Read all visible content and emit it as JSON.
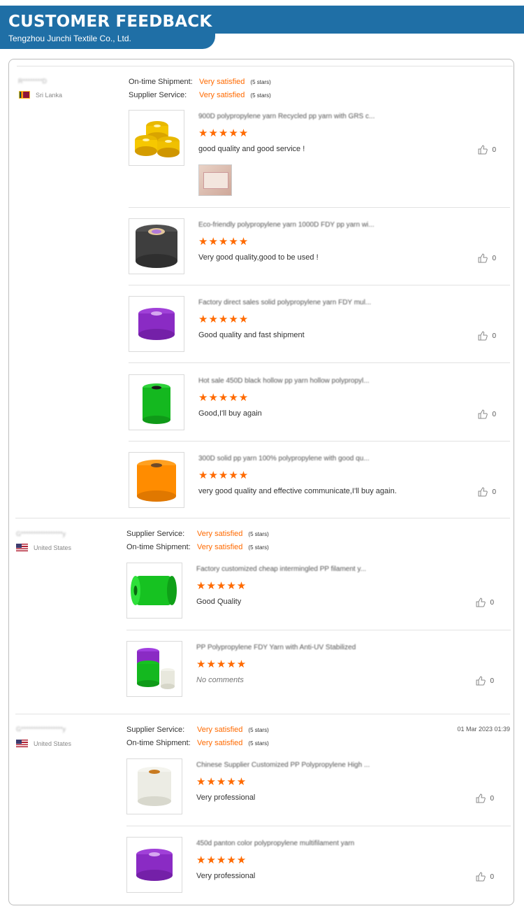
{
  "header": {
    "title": "CUSTOMER FEEDBACK",
    "subtitle": "Tengzhou Junchi Textile Co., Ltd."
  },
  "colors": {
    "brand": "#1f6fa6",
    "accent": "#ff6a00"
  },
  "reviews": [
    {
      "name": "R********D",
      "country": "Sri Lanka",
      "flag": "flag-sri-lanka-icon",
      "date": "",
      "ratings": [
        {
          "label": "On-time Shipment:",
          "value": "Very satisfied",
          "stars": "(5 stars)"
        },
        {
          "label": "Supplier Service:",
          "value": "Very satisfied",
          "stars": "(5 stars)"
        }
      ],
      "items": [
        {
          "product": "900D polypropylene yarn Recycled pp yarn with GRS c...",
          "stars": "★★★★★",
          "rating": 5,
          "comment": "good quality and good service !",
          "likes": "0",
          "image": "yellow-yarn-spools"
        },
        {
          "product": "Eco-friendly polypropylene yarn 1000D FDY pp yarn wi...",
          "stars": "★★★★★",
          "rating": 5,
          "comment": "Very good quality,good to be used !",
          "likes": "0",
          "image": "dark-gray-yarn-spool"
        },
        {
          "product": "Factory direct sales solid polypropylene yarn FDY mul...",
          "stars": "★★★★★",
          "rating": 5,
          "comment": "Good quality and fast shipment",
          "likes": "0",
          "image": "purple-yarn-spool"
        },
        {
          "product": "Hot sale 450D black hollow pp yarn hollow polypropyl...",
          "stars": "★★★★★",
          "rating": 5,
          "comment": "Good,I'll buy again",
          "likes": "0",
          "image": "green-yarn-spool"
        },
        {
          "product": "300D solid pp yarn 100% polypropylene with good qu...",
          "stars": "★★★★★",
          "rating": 5,
          "comment": "very good quality and effective communicate,I'll buy again.",
          "likes": "0",
          "image": "orange-yarn-spool"
        }
      ]
    },
    {
      "name": "G*****************y",
      "country": "United States",
      "flag": "flag-united-states-icon",
      "date": "",
      "ratings": [
        {
          "label": "Supplier Service:",
          "value": "Very satisfied",
          "stars": "(5 stars)"
        },
        {
          "label": "On-time Shipment:",
          "value": "Very satisfied",
          "stars": "(5 stars)"
        }
      ],
      "items": [
        {
          "product": "Factory customized cheap intermingled PP filament y...",
          "stars": "★★★★★",
          "rating": 5,
          "comment": "Good Quality",
          "likes": "0",
          "image": "green-yarn-spool-side"
        },
        {
          "product": "PP Polypropylene FDY Yarn with Anti-UV Stabilized",
          "stars": "★★★★★",
          "rating": 5,
          "comment": "No comments",
          "likes": "0",
          "image": "multi-color-yarn-spools"
        }
      ]
    },
    {
      "name": "G*****************y",
      "country": "United States",
      "flag": "flag-united-states-icon",
      "date": "01 Mar 2023 01:39",
      "ratings": [
        {
          "label": "Supplier Service:",
          "value": "Very satisfied",
          "stars": "(5 stars)"
        },
        {
          "label": "On-time Shipment:",
          "value": "Very satisfied",
          "stars": "(5 stars)"
        }
      ],
      "items": [
        {
          "product": "Chinese Supplier Customized PP Polypropylene High ...",
          "stars": "★★★★★",
          "rating": 5,
          "comment": "Very professional",
          "likes": "0",
          "image": "white-yarn-spool"
        },
        {
          "product": "450d panton color polypropylene multifilament yarn",
          "stars": "★★★★★",
          "rating": 5,
          "comment": "Very professional",
          "likes": "0",
          "image": "purple-yarn-spool"
        }
      ]
    }
  ]
}
